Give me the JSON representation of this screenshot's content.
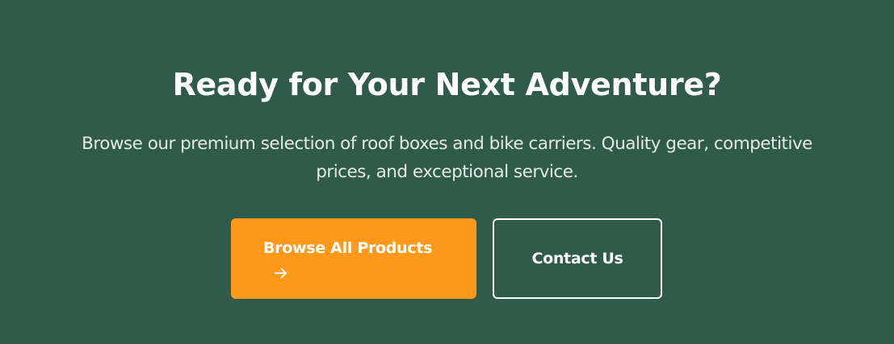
{
  "cta": {
    "title": "Ready for Your Next Adventure?",
    "description": "Browse our premium selection of roof boxes and bike carriers. Quality gear, competitive prices, and exceptional service.",
    "primary_button": {
      "label": "Browse All Products",
      "icon": "arrow-right-icon"
    },
    "secondary_button": {
      "label": "Contact Us"
    }
  },
  "colors": {
    "background": "#305a4a",
    "primary_button": "#ff991c",
    "text": "#ffffff",
    "subtitle_text": "#e3ebe7"
  }
}
